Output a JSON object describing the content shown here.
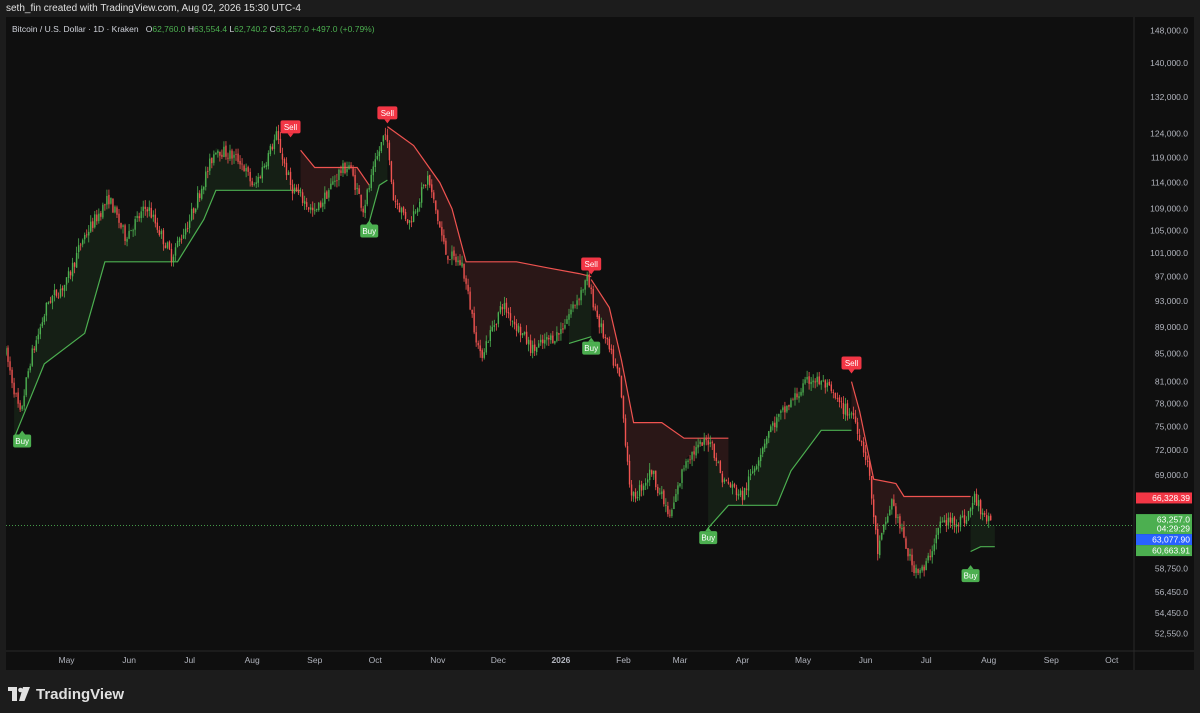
{
  "header": {
    "credit": "seth_fin created with TradingView.com, Aug 02, 2026 15:30 UTC-4"
  },
  "legend": {
    "symbol": "Bitcoin / U.S. Dollar · 1D · Kraken",
    "o_label": "O",
    "o": "62,760.0",
    "h_label": "H",
    "h": "63,554.4",
    "l_label": "L",
    "l": "62,740.2",
    "c_label": "C",
    "c": "63,257.0",
    "change": "+497.0 (+0.79%)"
  },
  "footer": {
    "brand": "TradingView"
  },
  "colors": {
    "up": "#26a69a",
    "up_bright": "#4caf50",
    "down": "#ef5350",
    "down_dark": "#b71c1c",
    "trail_up": "#4caf50",
    "trail_down": "#ef5350",
    "price_tag": "#4caf50",
    "blue_tag": "#2962ff",
    "red_tag": "#f23645"
  },
  "chart_data": {
    "type": "candlestick",
    "price_scale": "log",
    "y_ticks": [
      148000,
      140000,
      132000,
      124000,
      119000,
      114000,
      109000,
      105000,
      101000,
      97000,
      93000,
      89000,
      85000,
      81000,
      78000,
      75000,
      72000,
      69000,
      66000,
      63000,
      60600,
      58750,
      56450,
      54450,
      52550
    ],
    "y_tick_labels": [
      "148,000.0",
      "140,000.0",
      "132,000.0",
      "124,000.0",
      "119,000.0",
      "114,000.0",
      "109,000.0",
      "105,000.0",
      "101,000.0",
      "97,000.0",
      "93,000.0",
      "89,000.0",
      "85,000.0",
      "81,000.0",
      "78,000.0",
      "75,000.0",
      "72,000.0",
      "69,000.0",
      "",
      "",
      "",
      "58,750.0",
      "56,450.0",
      "54,450.0",
      "52,550.0"
    ],
    "x_labels": [
      {
        "label": "May",
        "date": "2025-05-01"
      },
      {
        "label": "Jun",
        "date": "2025-06-01"
      },
      {
        "label": "Jul",
        "date": "2025-07-01"
      },
      {
        "label": "Aug",
        "date": "2025-08-01"
      },
      {
        "label": "Sep",
        "date": "2025-09-01"
      },
      {
        "label": "Oct",
        "date": "2025-10-01"
      },
      {
        "label": "Nov",
        "date": "2025-11-01"
      },
      {
        "label": "Dec",
        "date": "2025-12-01"
      },
      {
        "label": "2026",
        "date": "2026-01-01"
      },
      {
        "label": "Feb",
        "date": "2026-02-01"
      },
      {
        "label": "Mar",
        "date": "2026-03-01"
      },
      {
        "label": "Apr",
        "date": "2026-04-01"
      },
      {
        "label": "May",
        "date": "2026-05-01"
      },
      {
        "label": "Jun",
        "date": "2026-06-01"
      },
      {
        "label": "Jul",
        "date": "2026-07-01"
      },
      {
        "label": "Aug",
        "date": "2026-08-01"
      },
      {
        "label": "Sep",
        "date": "2026-09-01"
      },
      {
        "label": "Oct",
        "date": "2026-10-01"
      }
    ],
    "x_range": [
      "2025-04-01",
      "2026-10-12"
    ],
    "last_date": "2026-08-02",
    "price_path": [
      [
        "2025-04-01",
        85000
      ],
      [
        "2025-04-08",
        76500
      ],
      [
        "2025-04-13",
        84000
      ],
      [
        "2025-04-22",
        93000
      ],
      [
        "2025-05-01",
        96000
      ],
      [
        "2025-05-09",
        103500
      ],
      [
        "2025-05-22",
        111000
      ],
      [
        "2025-05-30",
        104000
      ],
      [
        "2025-06-10",
        109500
      ],
      [
        "2025-06-22",
        100500
      ],
      [
        "2025-07-01",
        107000
      ],
      [
        "2025-07-10",
        116500
      ],
      [
        "2025-07-14",
        121000
      ],
      [
        "2025-07-26",
        118500
      ],
      [
        "2025-08-02",
        113000
      ],
      [
        "2025-08-13",
        123500
      ],
      [
        "2025-08-20",
        113500
      ],
      [
        "2025-09-01",
        108000
      ],
      [
        "2025-09-13",
        116000
      ],
      [
        "2025-09-18",
        117500
      ],
      [
        "2025-09-25",
        109000
      ],
      [
        "2025-10-06",
        125000
      ],
      [
        "2025-10-10",
        111000
      ],
      [
        "2025-10-18",
        106500
      ],
      [
        "2025-10-27",
        115000
      ],
      [
        "2025-11-05",
        101000
      ],
      [
        "2025-11-13",
        99000
      ],
      [
        "2025-11-22",
        84500
      ],
      [
        "2025-12-03",
        92500
      ],
      [
        "2025-12-18",
        85500
      ],
      [
        "2025-12-31",
        88000
      ],
      [
        "2026-01-14",
        96500
      ],
      [
        "2026-01-20",
        89500
      ],
      [
        "2026-01-30",
        81500
      ],
      [
        "2026-02-05",
        66000
      ],
      [
        "2026-02-15",
        69500
      ],
      [
        "2026-02-24",
        64000
      ],
      [
        "2026-03-04",
        71000
      ],
      [
        "2026-03-16",
        73500
      ],
      [
        "2026-03-22",
        68500
      ],
      [
        "2026-04-01",
        66500
      ],
      [
        "2026-04-14",
        74500
      ],
      [
        "2026-04-26",
        78500
      ],
      [
        "2026-05-05",
        81500
      ],
      [
        "2026-05-12",
        80500
      ],
      [
        "2026-05-20",
        77500
      ],
      [
        "2026-05-26",
        76500
      ],
      [
        "2026-06-02",
        70500
      ],
      [
        "2026-06-07",
        60500
      ],
      [
        "2026-06-14",
        66000
      ],
      [
        "2026-06-24",
        59000
      ],
      [
        "2026-06-30",
        58500
      ],
      [
        "2026-07-08",
        63500
      ],
      [
        "2026-07-21",
        64000
      ],
      [
        "2026-07-25",
        66300
      ],
      [
        "2026-08-02",
        63257
      ]
    ],
    "trail_segments": [
      {
        "dir": "up",
        "points": [
          [
            "2025-04-05",
            73500
          ],
          [
            "2025-04-20",
            83500
          ],
          [
            "2025-05-10",
            88000
          ],
          [
            "2025-05-20",
            99500
          ],
          [
            "2025-06-25",
            99500
          ],
          [
            "2025-07-08",
            107000
          ],
          [
            "2025-07-14",
            112500
          ],
          [
            "2025-08-25",
            112500
          ]
        ]
      },
      {
        "dir": "down",
        "points": [
          [
            "2025-08-25",
            120500
          ],
          [
            "2025-09-01",
            117000
          ],
          [
            "2025-09-22",
            117000
          ],
          [
            "2025-09-28",
            113500
          ]
        ]
      },
      {
        "dir": "up",
        "points": [
          [
            "2025-09-28",
            106500
          ],
          [
            "2025-10-03",
            113500
          ],
          [
            "2025-10-07",
            114500
          ]
        ]
      },
      {
        "dir": "down",
        "points": [
          [
            "2025-10-07",
            125500
          ],
          [
            "2025-10-20",
            121500
          ],
          [
            "2025-11-02",
            114000
          ],
          [
            "2025-11-08",
            109000
          ],
          [
            "2025-11-15",
            99500
          ],
          [
            "2025-12-10",
            99500
          ],
          [
            "2025-12-25",
            98500
          ],
          [
            "2026-01-10",
            97500
          ],
          [
            "2026-01-16",
            97000
          ]
        ]
      },
      {
        "dir": "up",
        "points": [
          [
            "2026-01-05",
            86500
          ],
          [
            "2026-01-16",
            87500
          ]
        ]
      },
      {
        "dir": "down",
        "points": [
          [
            "2026-01-16",
            96500
          ],
          [
            "2026-01-25",
            92000
          ],
          [
            "2026-01-31",
            84000
          ],
          [
            "2026-02-06",
            75500
          ],
          [
            "2026-02-20",
            75500
          ],
          [
            "2026-03-03",
            73500
          ],
          [
            "2026-03-25",
            73500
          ]
        ]
      },
      {
        "dir": "up",
        "points": [
          [
            "2026-03-15",
            63000
          ],
          [
            "2026-03-25",
            65500
          ],
          [
            "2026-04-18",
            65500
          ],
          [
            "2026-04-25",
            69500
          ],
          [
            "2026-05-10",
            74500
          ],
          [
            "2026-05-25",
            74500
          ]
        ]
      },
      {
        "dir": "down",
        "points": [
          [
            "2026-05-25",
            81000
          ],
          [
            "2026-05-29",
            77000
          ],
          [
            "2026-06-05",
            68500
          ],
          [
            "2026-06-16",
            68000
          ],
          [
            "2026-06-20",
            66500
          ],
          [
            "2026-07-23",
            66500
          ]
        ]
      },
      {
        "dir": "up",
        "points": [
          [
            "2026-07-23",
            60500
          ],
          [
            "2026-07-28",
            61000
          ],
          [
            "2026-08-04",
            61000
          ]
        ]
      }
    ],
    "signals": [
      {
        "label": "Buy",
        "date": "2025-04-09",
        "price": 74600,
        "side": "below"
      },
      {
        "label": "Sell",
        "date": "2025-08-20",
        "price": 123000,
        "side": "above"
      },
      {
        "label": "Buy",
        "date": "2025-09-28",
        "price": 107000,
        "side": "below"
      },
      {
        "label": "Sell",
        "date": "2025-10-07",
        "price": 126000,
        "side": "above"
      },
      {
        "label": "Sell",
        "date": "2026-01-16",
        "price": 97200,
        "side": "above"
      },
      {
        "label": "Buy",
        "date": "2026-01-16",
        "price": 87500,
        "side": "below"
      },
      {
        "label": "Buy",
        "date": "2026-03-15",
        "price": 63200,
        "side": "below"
      },
      {
        "label": "Sell",
        "date": "2026-05-25",
        "price": 82000,
        "side": "above"
      },
      {
        "label": "Buy",
        "date": "2026-07-23",
        "price": 59200,
        "side": "below"
      }
    ],
    "price_tags": [
      {
        "price": 66328.39,
        "label": "66,328.39",
        "color": "#f23645"
      },
      {
        "price": 63257.0,
        "label": "63,257.0",
        "color": "#4caf50",
        "sub": "04:29:29"
      },
      {
        "price": 63077.9,
        "label": "63,077.90",
        "color": "#2962ff"
      },
      {
        "price": 60663.91,
        "label": "60,663.91",
        "color": "#4caf50"
      }
    ],
    "current_price": 63257.0
  }
}
